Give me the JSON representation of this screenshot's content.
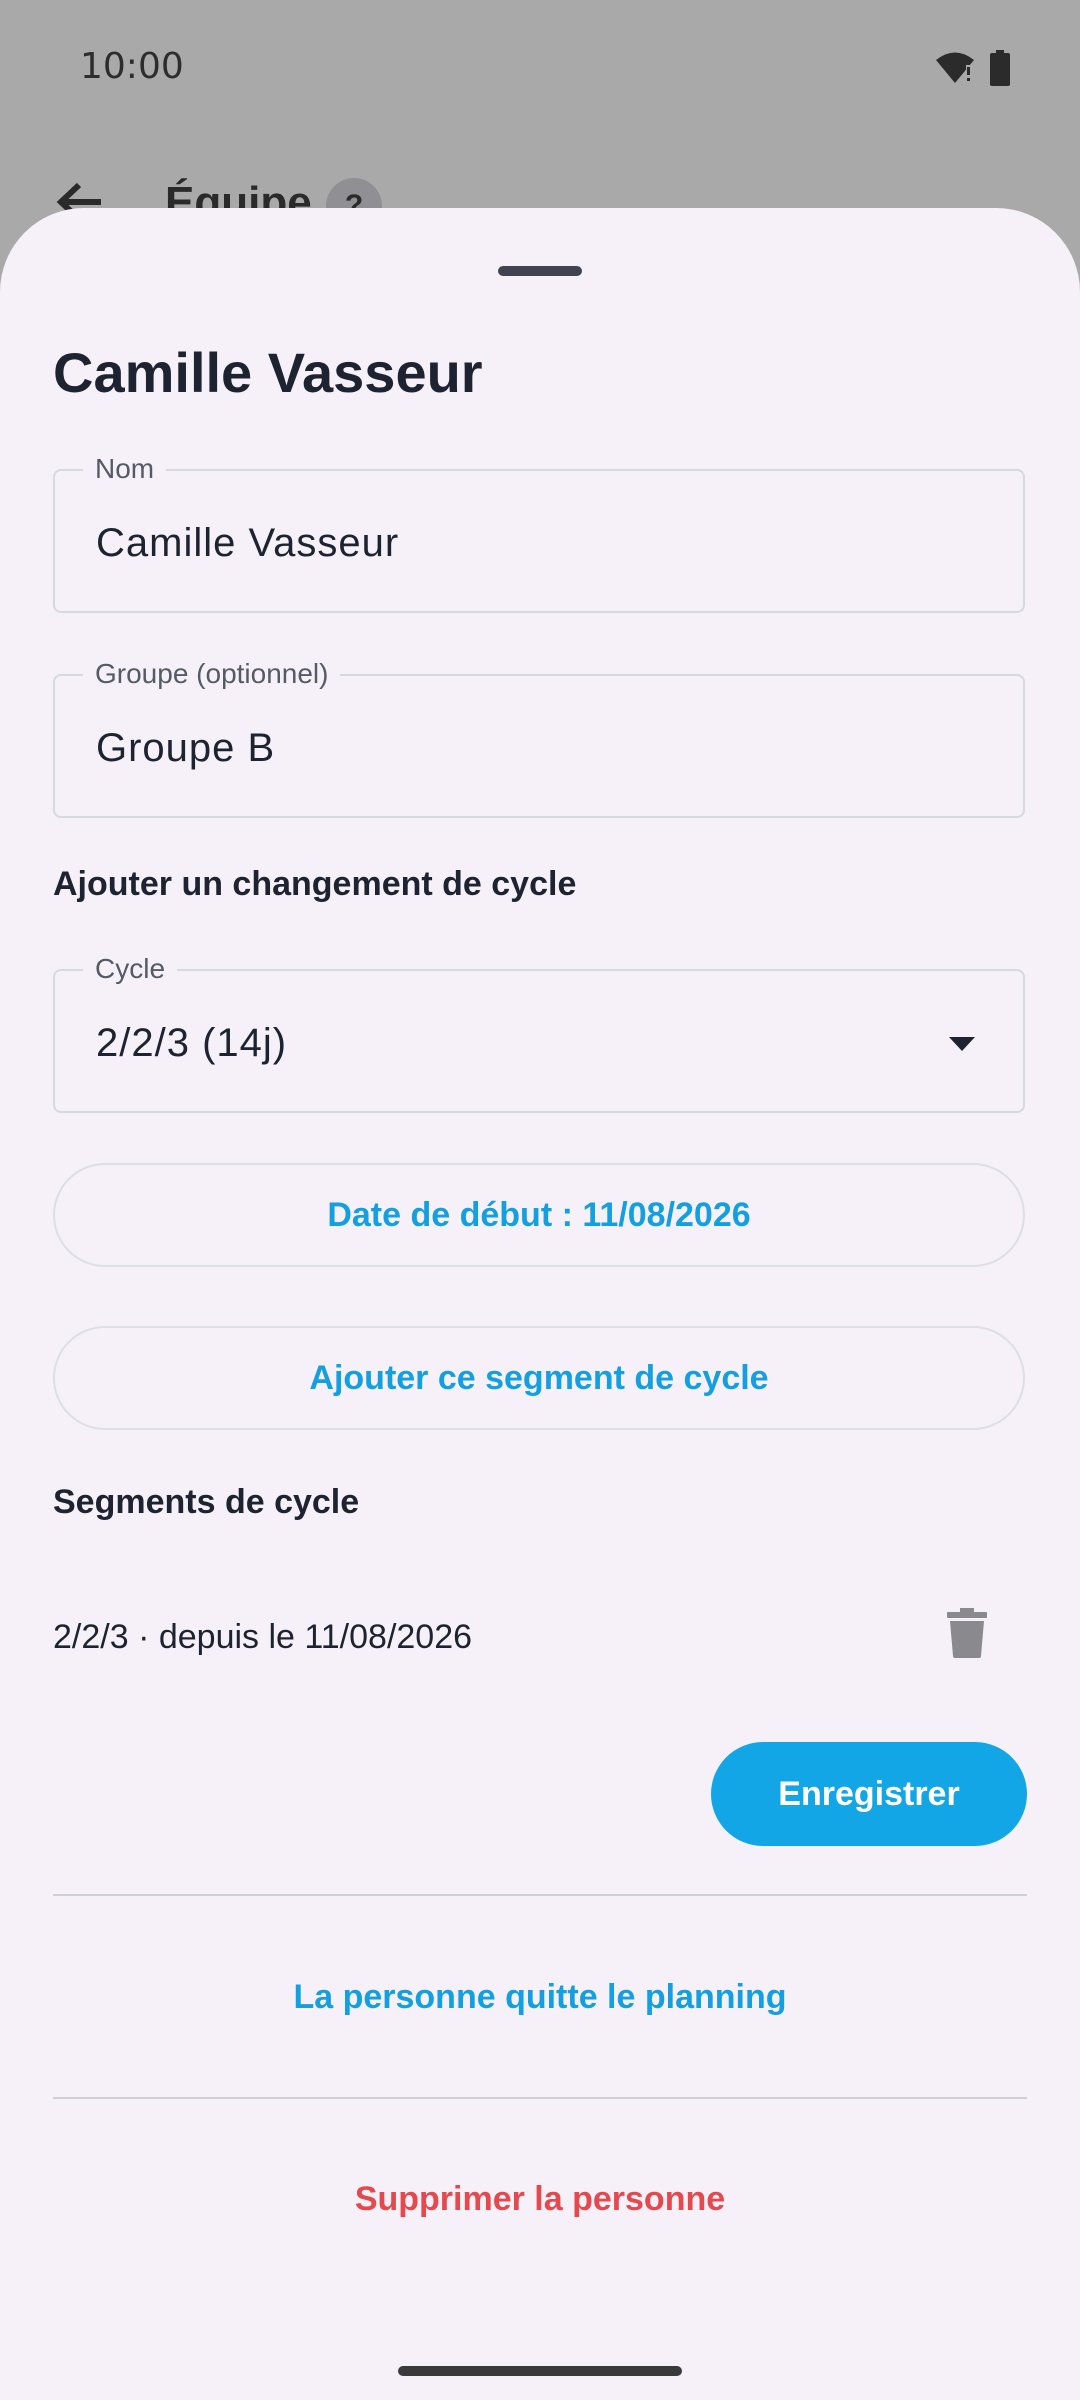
{
  "status_bar": {
    "time": "10:00",
    "icons": [
      "wifi-alert-icon",
      "battery-icon"
    ]
  },
  "background_screen": {
    "title": "Équipe",
    "badge": "?"
  },
  "sheet": {
    "title": "Camille Vasseur",
    "name_field": {
      "label": "Nom",
      "value": "Camille Vasseur"
    },
    "group_field": {
      "label": "Groupe (optionnel)",
      "value": "Groupe B"
    },
    "add_cycle_section": "Ajouter un changement de cycle",
    "cycle_field": {
      "label": "Cycle",
      "value": "2/2/3 (14j)"
    },
    "start_date_button": "Date de début : 11/08/2026",
    "add_segment_button": "Ajouter ce segment de cycle",
    "segments_section": "Segments de cycle",
    "segments": [
      {
        "text": "2/2/3 · depuis le 11/08/2026"
      }
    ],
    "save_button": "Enregistrer",
    "leave_planning_action": "La personne quitte le planning",
    "delete_person_action": "Supprimer la personne"
  },
  "colors": {
    "accent": "#13a6e6",
    "danger": "#e5484d",
    "sheet_bg": "#f6f1f8",
    "scrim": "#a9a9a9"
  }
}
